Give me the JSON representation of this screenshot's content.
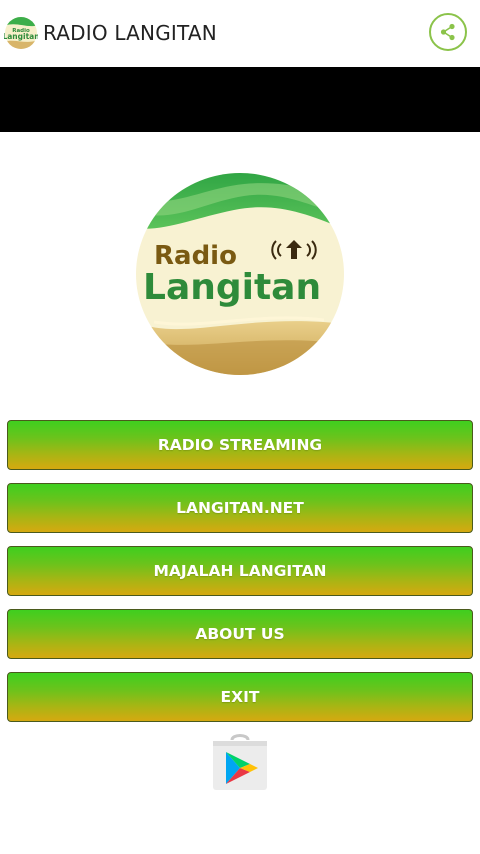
{
  "app_bar": {
    "title": "RADIO LANGITAN",
    "icon": "radio-langitan-app-icon",
    "share_icon": "share-icon"
  },
  "logo": {
    "line1": "Radio",
    "line2": "Langitan",
    "icon": "radio-broadcast-icon"
  },
  "menu": {
    "items": [
      {
        "label": "RADIO STREAMING"
      },
      {
        "label": "LANGITAN.NET"
      },
      {
        "label": "MAJALAH LANGITAN"
      },
      {
        "label": "ABOUT US"
      },
      {
        "label": "EXIT"
      }
    ]
  },
  "play_store": {
    "icon": "google-play-store-icon"
  },
  "colors": {
    "accent_green": "#8bc34a",
    "button_top": "#3fcf1f",
    "button_bottom": "#d6a910",
    "logo_green": "#2e8b3a",
    "logo_cream": "#f6efc9"
  }
}
